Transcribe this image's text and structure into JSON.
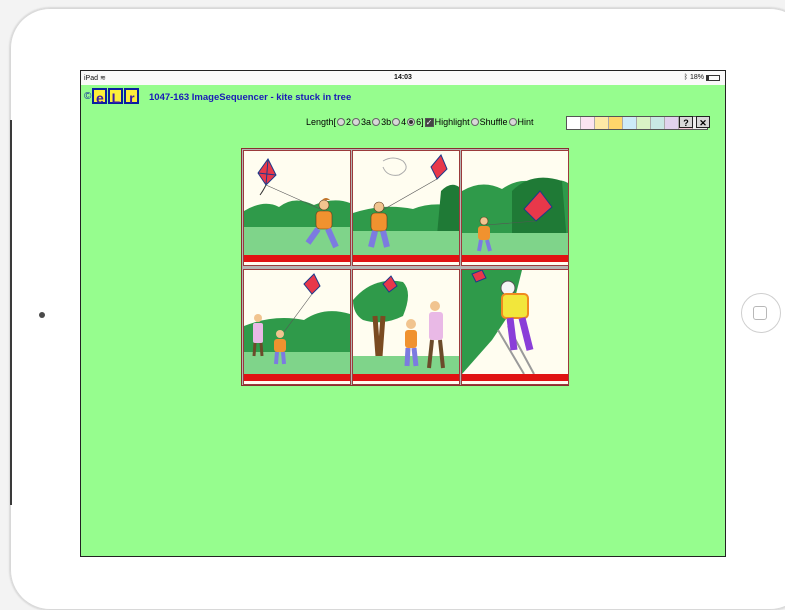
{
  "status": {
    "device": "iPad",
    "time": "14:03",
    "battery": "18%",
    "battery_level": 0.18
  },
  "header": {
    "copyright": "©",
    "logo_letters": [
      "e",
      "L",
      "r"
    ],
    "title": "1047-163 ImageSequencer - kite stuck in tree"
  },
  "controls": {
    "length_label": "Length[",
    "options": [
      "2",
      "3a",
      "3b",
      "4",
      "6]"
    ],
    "selected_option": "6]",
    "highlight_label": "Highlight",
    "highlight_checked": true,
    "shuffle_label": "Shuffle",
    "shuffle_checked": false,
    "hint_label": "Hint",
    "hint_checked": false,
    "swatches": [
      "#ffffff",
      "#fbe4f1",
      "#fde9a6",
      "#ffd66b",
      "#cdebf8",
      "#d9f3c5",
      "#c9e8e4",
      "#e0d2ed",
      "#f5c9d5",
      "#eeeeee"
    ],
    "help_label": "?",
    "close_label": "✕"
  },
  "panels": [
    {
      "id": "p1",
      "scene": "boy-running-with-kite"
    },
    {
      "id": "p2",
      "scene": "kite-in-wind"
    },
    {
      "id": "p3",
      "scene": "kite-caught-in-tree"
    },
    {
      "id": "p4",
      "scene": "man-approaching"
    },
    {
      "id": "p5",
      "scene": "man-and-boy-at-tree"
    },
    {
      "id": "p6",
      "scene": "man-on-ladder-retrieving-kite"
    }
  ],
  "colors": {
    "screen_bg": "#96fd8e",
    "title": "#1a1ab8",
    "panel_border": "#9b3b3b",
    "red_bar": "#e01212"
  }
}
